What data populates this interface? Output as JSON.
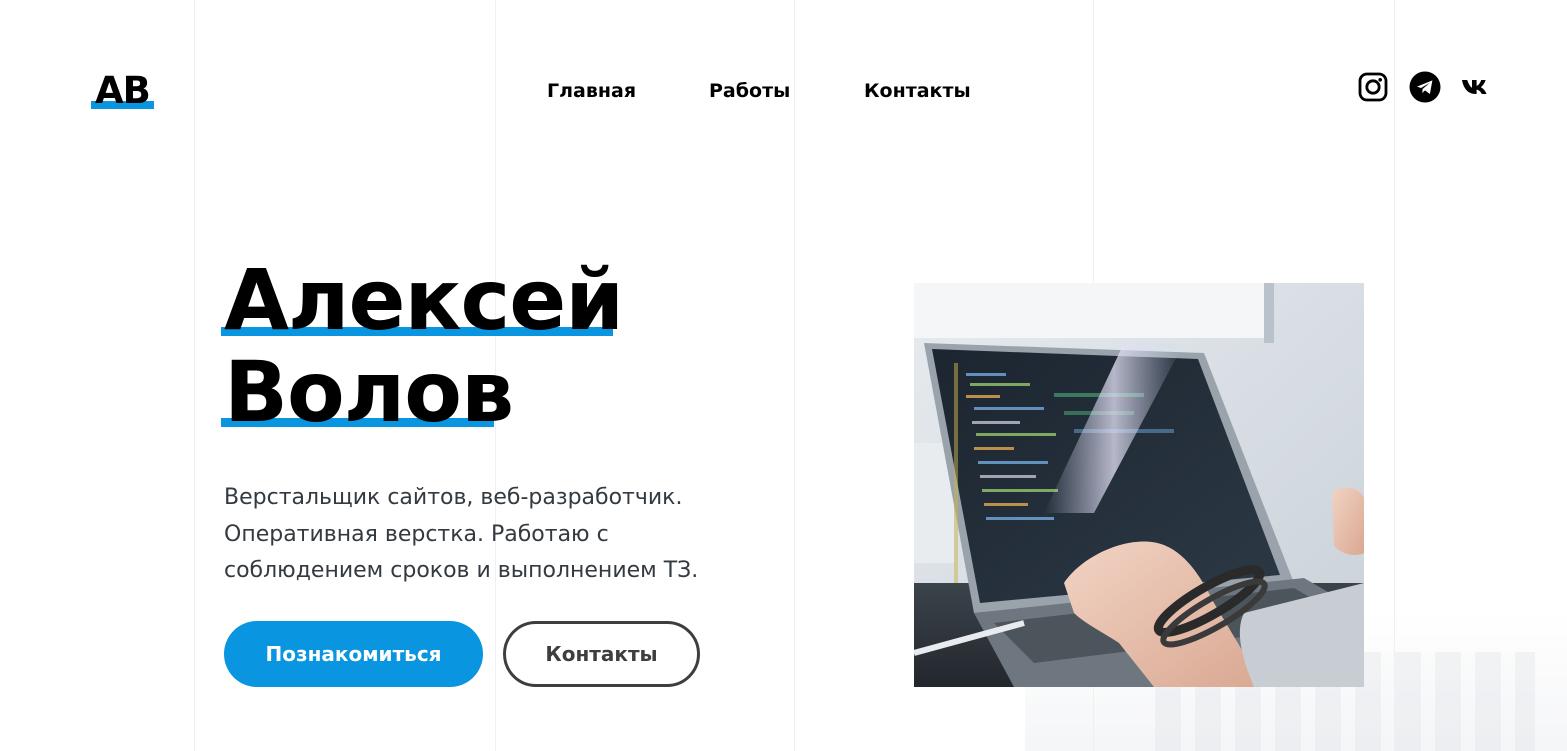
{
  "logo": {
    "text": "АВ"
  },
  "nav": {
    "items": [
      {
        "label": "Главная"
      },
      {
        "label": "Работы"
      },
      {
        "label": "Контакты"
      }
    ]
  },
  "social": {
    "icons": [
      "instagram-icon",
      "telegram-icon",
      "vk-icon"
    ]
  },
  "hero": {
    "first_name": "Алексей",
    "last_name": "Волов",
    "description_lines": [
      "Верстальщик сайтов, веб-разработчик.",
      "Оперативная верстка. Работаю с",
      "соблюдением сроков и выполнением ТЗ."
    ],
    "primary_button": "Познакомиться",
    "secondary_button": "Контакты"
  },
  "colors": {
    "accent": "#0a95e0",
    "text": "#000000",
    "body_text": "#333a40",
    "outline": "#3e3e3e"
  }
}
